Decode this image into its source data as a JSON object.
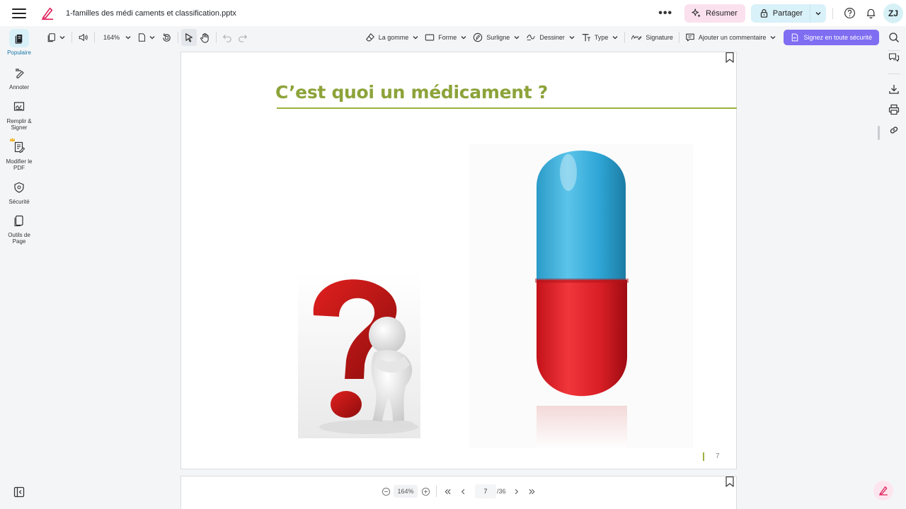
{
  "header": {
    "document_title": "1-familles des médi caments et classification.pptx",
    "more_label": "•••",
    "summarize_label": "Résumer",
    "share_label": "Partager",
    "avatar_initials": "ZJ"
  },
  "toolbar": {
    "zoom": "164%",
    "eraser_label": "La gomme",
    "shape_label": "Forme",
    "highlight_label": "Surligne",
    "draw_label": "Dessiner",
    "type_label": "Type",
    "signature_label": "Signature",
    "comment_label": "Ajouter un commentaire",
    "sign_secure_label": "Signez en toute sécurité"
  },
  "sidebar": {
    "items": [
      {
        "label": "Populaire",
        "icon": "stack-icon",
        "active": true
      },
      {
        "label": "Annoter",
        "icon": "pen-icon",
        "active": false
      },
      {
        "label": "Remplir & Signer",
        "icon": "sign-icon",
        "active": false
      },
      {
        "label": "Modifier le PDF",
        "icon": "edit-pdf-icon",
        "active": false
      },
      {
        "label": "Sécurité",
        "icon": "shield-icon",
        "active": false
      },
      {
        "label": "Outils de Page",
        "icon": "pages-icon",
        "active": false
      }
    ]
  },
  "slide": {
    "title": "C’est quoi un médicament ?",
    "page_number": "7",
    "accent_color": "#8ca33a"
  },
  "bottom_nav": {
    "zoom": "164%",
    "current_page": "7",
    "total_pages": "/36"
  },
  "colors": {
    "brand_pink": "#e0245e",
    "primary_purple": "#7f6df2",
    "share_bg": "#d9f1f8",
    "summarize_bg": "#fbe0ee"
  }
}
